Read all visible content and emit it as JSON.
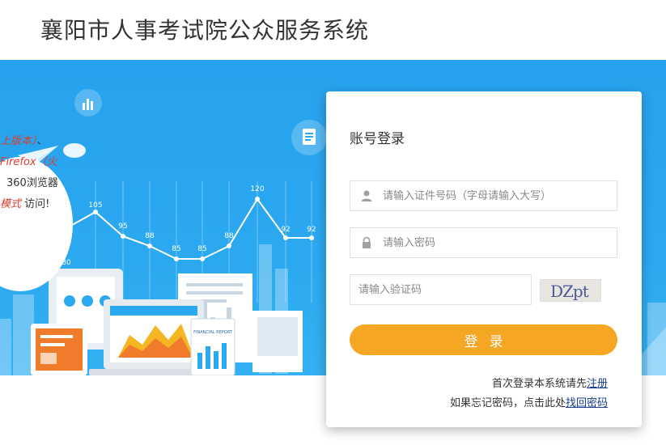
{
  "header": {
    "title": "襄阳市人事考试院公众服务系统"
  },
  "banner": {
    "bubble_lines": [
      {
        "red": "上版本）",
        "normal": "、"
      },
      {
        "red": "Firefox（火",
        "normal": ""
      },
      {
        "red": "",
        "normal": "360浏览器"
      },
      {
        "red": "模式",
        "normal": " 访问!"
      }
    ],
    "chart_labels": [
      "105",
      "95",
      "88",
      "85",
      "85",
      "88",
      "120",
      "92",
      "92",
      "80"
    ],
    "report_label": "FINANCIAL REPORT"
  },
  "login": {
    "title": "账号登录",
    "id_placeholder": "请输入证件号码（字母请输入大写）",
    "password_placeholder": "请输入密码",
    "captcha_placeholder": "请输入验证码",
    "captcha_text": "DZpt",
    "button_label": "登录",
    "register_prefix": "首次登录本系统请先",
    "register_link": "注册",
    "forgot_prefix": "如果忘记密码，点击此处",
    "forgot_link": "找回密码"
  },
  "colors": {
    "banner": "#2aa8f0",
    "button": "#f5a623",
    "link": "#1a3c8c",
    "accent_red": "#e03a2f"
  }
}
